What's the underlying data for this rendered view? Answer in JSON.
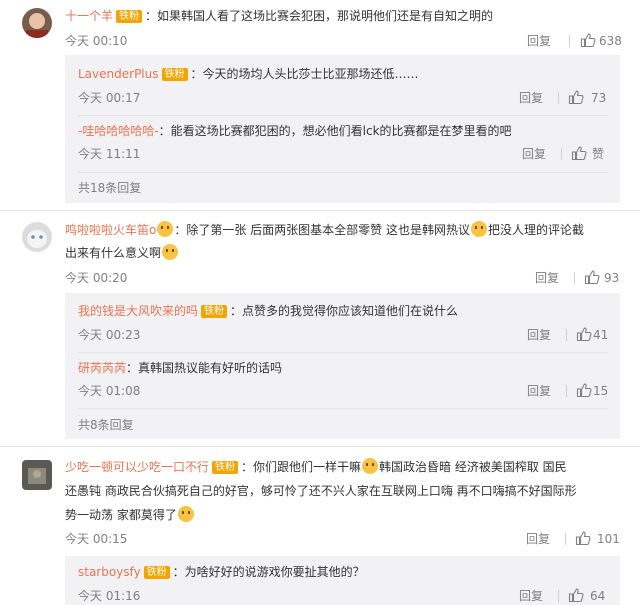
{
  "comments": [
    {
      "username": "十一个羊",
      "badge": "铁粉",
      "text": "：如果韩国人看了这场比赛会犯困，那说明他们还是有自知之明的",
      "time": "今天 00:10",
      "reply": "回复",
      "likes": "638",
      "replies": [
        {
          "username": "LavenderPlus",
          "badge": "铁粉",
          "text": "：今天的场均人头比莎士比亚那场还低……",
          "time": "今天 00:17",
          "reply": "回复",
          "likes": "73"
        },
        {
          "username": "-哇哈哈哈哈哈-",
          "badge": "",
          "text": "：能看这场比赛都犯困的，想必他们看lck的比赛都是在梦里看的吧",
          "time": "今天 11:11",
          "reply": "回复",
          "likes": "赞"
        }
      ],
      "more": "共18条回复"
    },
    {
      "username": "鸣啦啦啦火车笛o",
      "badge": "",
      "text": "：除了第一张 后面两张图基本全部零赞 这也是韩网热议",
      "text_after_emoji": "把没人理的评论截",
      "text_line2": "出来有什么意义啊",
      "time": "今天 00:20",
      "reply": "回复",
      "likes": "93",
      "replies": [
        {
          "username": "我的钱是大风吹来的吗",
          "badge": "铁粉",
          "text": "：点赞多的我觉得你应该知道他们在说什么",
          "time": "今天 00:23",
          "reply": "回复",
          "likes": "41"
        },
        {
          "username": "研芮芮芮",
          "badge": "",
          "text": "：真韩国热议能有好听的话吗",
          "time": "今天 01:08",
          "reply": "回复",
          "likes": "15"
        }
      ],
      "more": "共8条回复"
    },
    {
      "username": "少吃一顿可以少吃一口不行",
      "badge": "铁粉",
      "text": "：你们跟他们一样干嘛",
      "text_after_emoji": "韩国政治昏暗 经济被美国榨取 国民",
      "text_line2": "还愚钝 商政民合伙搞死自己的好官，够可怜了还不兴人家在互联网上口嗨 再不口嗨搞不好国际形",
      "text_line3": "势一动荡 家都莫得了",
      "time": "今天 00:15",
      "reply": "回复",
      "likes": "101",
      "replies": [
        {
          "username": "starboysfy",
          "badge": "铁粉",
          "text": "：为啥好好的说游戏你要扯其他的？",
          "time": "今天 01:16",
          "reply": "回复",
          "likes": "64"
        }
      ]
    }
  ],
  "colors": {
    "username": "#eb7350",
    "badge": "#f2a400",
    "meta": "#808080",
    "subbox": "#f2f2f5"
  },
  "icons": {
    "like": "thumbs-up-icon"
  }
}
